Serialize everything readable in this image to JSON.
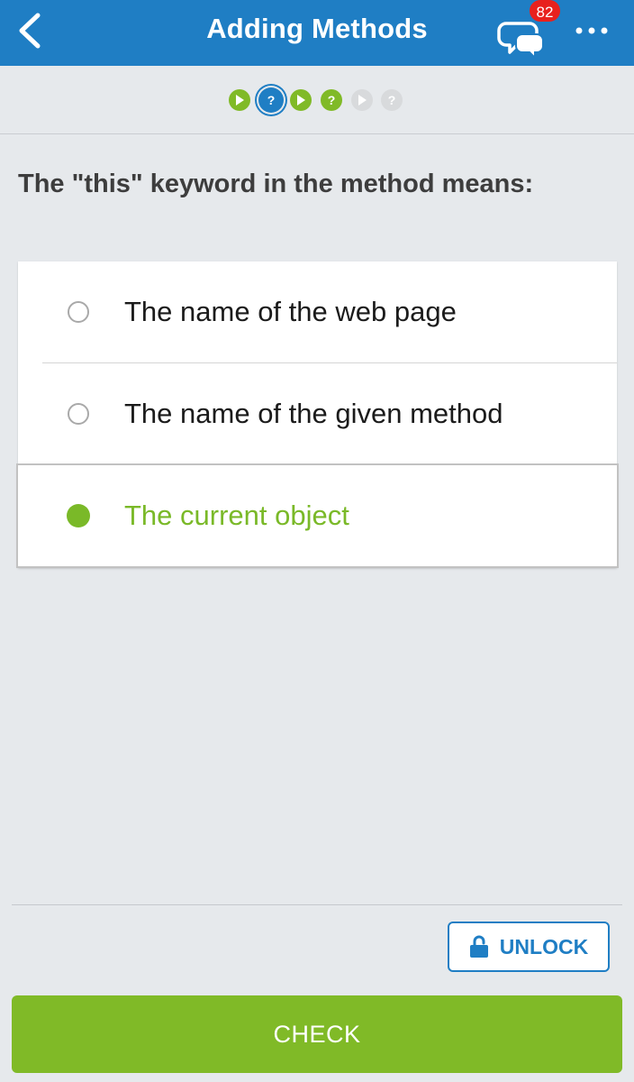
{
  "header": {
    "title": "Adding Methods",
    "comments_count": "82",
    "back_icon": "chevron-left-icon",
    "comments_icon": "speech-bubbles-icon",
    "more_icon": "more-horizontal-icon"
  },
  "progress": {
    "steps": [
      {
        "type": "play",
        "state": "done"
      },
      {
        "type": "question",
        "state": "current"
      },
      {
        "type": "play",
        "state": "done"
      },
      {
        "type": "question",
        "state": "done"
      },
      {
        "type": "play",
        "state": "locked"
      },
      {
        "type": "question",
        "state": "locked"
      }
    ],
    "question_glyph": "?"
  },
  "question": {
    "text": "The \"this\" keyword in the method means:"
  },
  "options": [
    {
      "label": "The name of the web page",
      "selected": false
    },
    {
      "label": "The name of the given method",
      "selected": false
    },
    {
      "label": "The current object",
      "selected": true
    }
  ],
  "actions": {
    "unlock_label": "UNLOCK",
    "check_label": "CHECK"
  },
  "colors": {
    "header_blue": "#1f7ec4",
    "green": "#80ba27",
    "badge_red": "#e8211d",
    "locked_gray": "#d8dadc"
  }
}
